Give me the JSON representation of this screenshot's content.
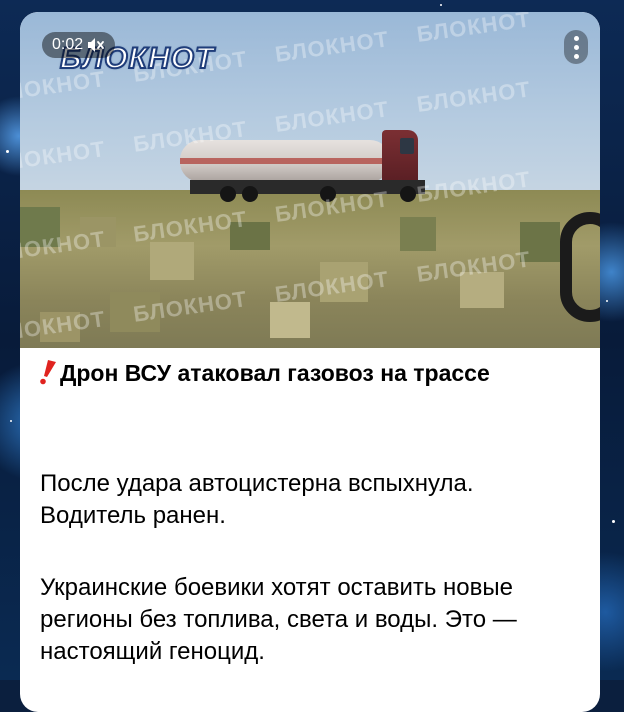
{
  "video": {
    "time": "0:02",
    "logo_text": "БЛОКНОТ",
    "watermark_text": "БЛОКНОТ",
    "mute_icon": "speaker-muted-icon",
    "more_icon": "more-vertical-icon"
  },
  "post": {
    "alert_icon": "red-exclamation-icon",
    "headline": "Дрон ВСУ атаковал газовоз на трассе",
    "paragraph1": "После удара автоцистерна вспыхнула. Водитель ранен.",
    "paragraph2": "Украинские боевики хотят оставить новые регионы без топлива, света и воды. Это — настоящий геноцид."
  },
  "colors": {
    "card_bg": "#ffffff",
    "alert_red": "#e0231f",
    "backdrop": "#0b1f3e"
  }
}
